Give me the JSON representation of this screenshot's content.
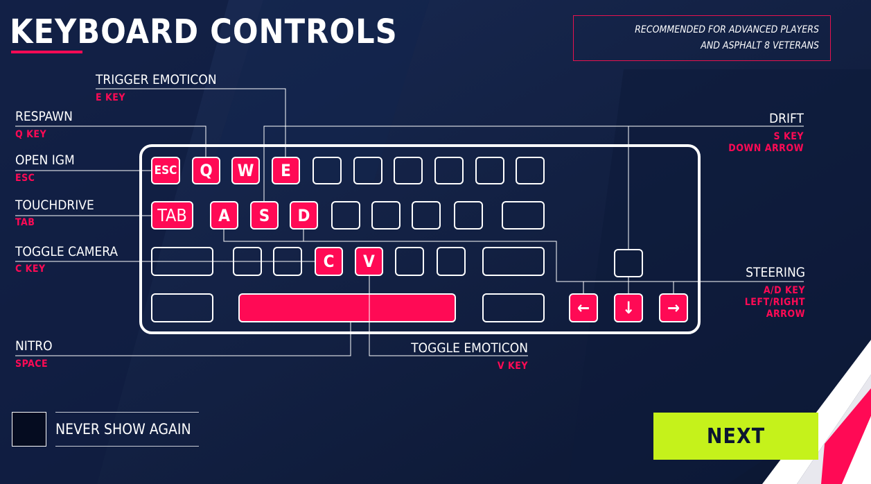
{
  "title": "KEYBOARD CONTROLS",
  "recommend": {
    "line1": "RECOMMENDED FOR ADVANCED PLAYERS",
    "line2": "AND ASPHALT 8 VETERANS"
  },
  "colors": {
    "accent": "#ff0a55",
    "next": "#c5f21b",
    "background": "#0b1631"
  },
  "keys": {
    "esc": "ESC",
    "q": "Q",
    "w": "W",
    "e": "E",
    "tab": "TAB",
    "a": "A",
    "s": "S",
    "d": "D",
    "c": "C",
    "v": "V",
    "left": "←",
    "down": "↓",
    "right": "→"
  },
  "labels": {
    "trigger_emoticon": {
      "name": "TRIGGER EMOTICON",
      "key": "E KEY"
    },
    "respawn": {
      "name": "RESPAWN",
      "key": "Q KEY"
    },
    "open_igm": {
      "name": "OPEN IGM",
      "key": "ESC"
    },
    "touchdrive": {
      "name": "TOUCHDRIVE",
      "key": "TAB"
    },
    "toggle_camera": {
      "name": "TOGGLE CAMERA",
      "key": "C KEY"
    },
    "nitro": {
      "name": "NITRO",
      "key": "SPACE"
    },
    "toggle_emoticon": {
      "name": "TOGGLE EMOTICON",
      "key": "V KEY"
    },
    "drift": {
      "name": "DRIFT",
      "key1": "S KEY",
      "key2": "DOWN ARROW"
    },
    "steering": {
      "name": "STEERING",
      "key1": "A/D KEY",
      "key2": "LEFT/RIGHT",
      "key3": "ARROW"
    }
  },
  "never_show": "NEVER SHOW AGAIN",
  "next": "NEXT"
}
